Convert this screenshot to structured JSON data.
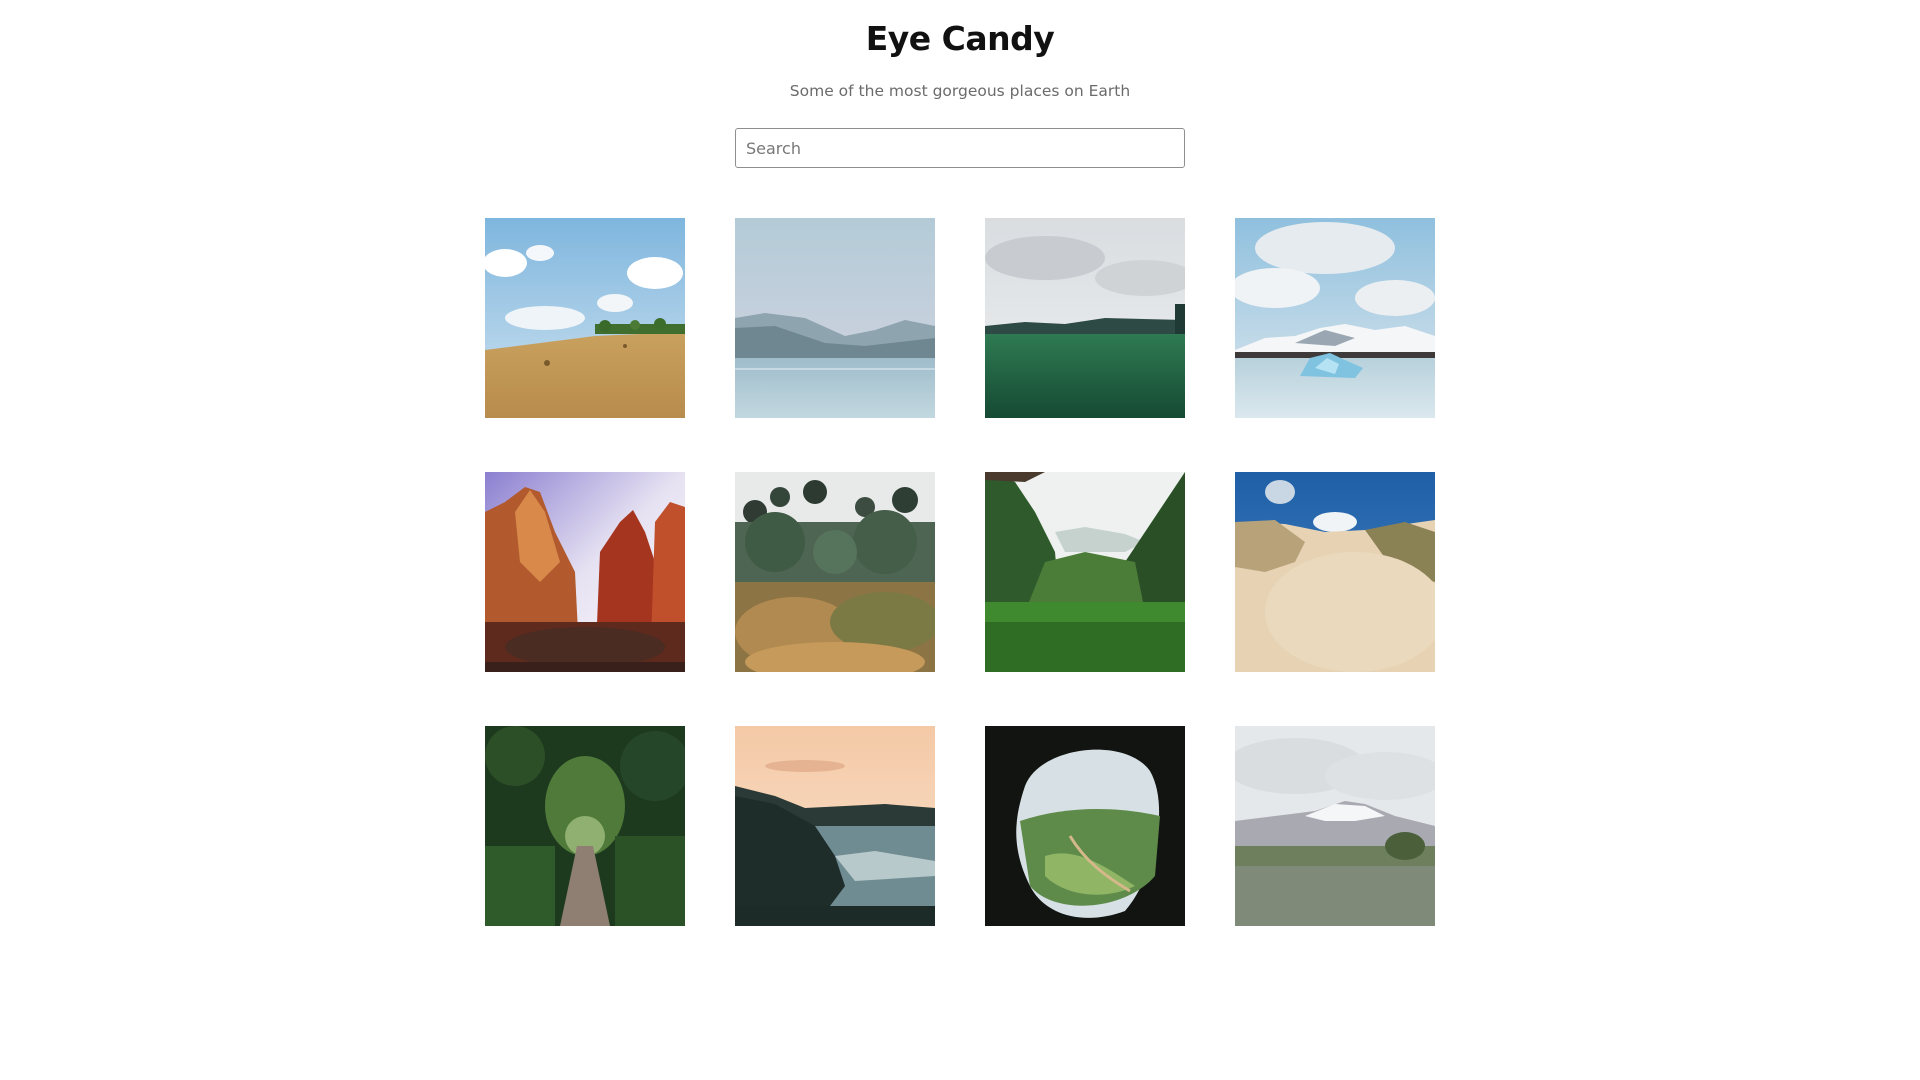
{
  "header": {
    "title": "Eye Candy",
    "subtitle": "Some of the most gorgeous places on Earth"
  },
  "search": {
    "placeholder": "Search",
    "value": ""
  },
  "gallery": {
    "photos": [
      {
        "name": "wheat-field-photo"
      },
      {
        "name": "mountain-lake-photo"
      },
      {
        "name": "green-meadow-photo"
      },
      {
        "name": "glacier-lagoon-photo"
      },
      {
        "name": "red-canyon-photo"
      },
      {
        "name": "forest-garden-photo"
      },
      {
        "name": "jungle-valley-photo"
      },
      {
        "name": "sand-dunes-photo"
      },
      {
        "name": "forest-path-photo"
      },
      {
        "name": "coastal-sunset-photo"
      },
      {
        "name": "cave-view-photo"
      },
      {
        "name": "snowy-mountain-meadow-photo"
      }
    ]
  }
}
